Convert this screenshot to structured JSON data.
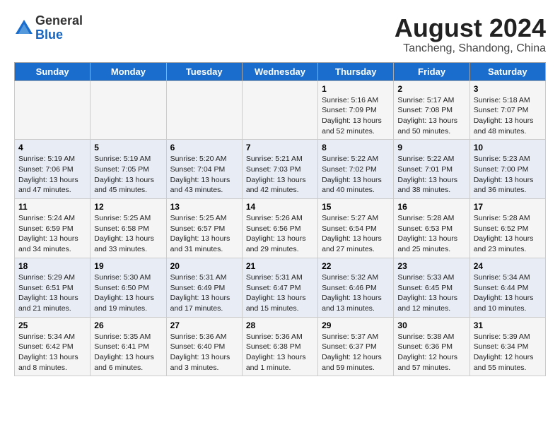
{
  "logo": {
    "general": "General",
    "blue": "Blue"
  },
  "title": {
    "month_year": "August 2024",
    "location": "Tancheng, Shandong, China"
  },
  "days_of_week": [
    "Sunday",
    "Monday",
    "Tuesday",
    "Wednesday",
    "Thursday",
    "Friday",
    "Saturday"
  ],
  "weeks": [
    [
      {
        "day": "",
        "info": ""
      },
      {
        "day": "",
        "info": ""
      },
      {
        "day": "",
        "info": ""
      },
      {
        "day": "",
        "info": ""
      },
      {
        "day": "1",
        "info": "Sunrise: 5:16 AM\nSunset: 7:09 PM\nDaylight: 13 hours\nand 52 minutes."
      },
      {
        "day": "2",
        "info": "Sunrise: 5:17 AM\nSunset: 7:08 PM\nDaylight: 13 hours\nand 50 minutes."
      },
      {
        "day": "3",
        "info": "Sunrise: 5:18 AM\nSunset: 7:07 PM\nDaylight: 13 hours\nand 48 minutes."
      }
    ],
    [
      {
        "day": "4",
        "info": "Sunrise: 5:19 AM\nSunset: 7:06 PM\nDaylight: 13 hours\nand 47 minutes."
      },
      {
        "day": "5",
        "info": "Sunrise: 5:19 AM\nSunset: 7:05 PM\nDaylight: 13 hours\nand 45 minutes."
      },
      {
        "day": "6",
        "info": "Sunrise: 5:20 AM\nSunset: 7:04 PM\nDaylight: 13 hours\nand 43 minutes."
      },
      {
        "day": "7",
        "info": "Sunrise: 5:21 AM\nSunset: 7:03 PM\nDaylight: 13 hours\nand 42 minutes."
      },
      {
        "day": "8",
        "info": "Sunrise: 5:22 AM\nSunset: 7:02 PM\nDaylight: 13 hours\nand 40 minutes."
      },
      {
        "day": "9",
        "info": "Sunrise: 5:22 AM\nSunset: 7:01 PM\nDaylight: 13 hours\nand 38 minutes."
      },
      {
        "day": "10",
        "info": "Sunrise: 5:23 AM\nSunset: 7:00 PM\nDaylight: 13 hours\nand 36 minutes."
      }
    ],
    [
      {
        "day": "11",
        "info": "Sunrise: 5:24 AM\nSunset: 6:59 PM\nDaylight: 13 hours\nand 34 minutes."
      },
      {
        "day": "12",
        "info": "Sunrise: 5:25 AM\nSunset: 6:58 PM\nDaylight: 13 hours\nand 33 minutes."
      },
      {
        "day": "13",
        "info": "Sunrise: 5:25 AM\nSunset: 6:57 PM\nDaylight: 13 hours\nand 31 minutes."
      },
      {
        "day": "14",
        "info": "Sunrise: 5:26 AM\nSunset: 6:56 PM\nDaylight: 13 hours\nand 29 minutes."
      },
      {
        "day": "15",
        "info": "Sunrise: 5:27 AM\nSunset: 6:54 PM\nDaylight: 13 hours\nand 27 minutes."
      },
      {
        "day": "16",
        "info": "Sunrise: 5:28 AM\nSunset: 6:53 PM\nDaylight: 13 hours\nand 25 minutes."
      },
      {
        "day": "17",
        "info": "Sunrise: 5:28 AM\nSunset: 6:52 PM\nDaylight: 13 hours\nand 23 minutes."
      }
    ],
    [
      {
        "day": "18",
        "info": "Sunrise: 5:29 AM\nSunset: 6:51 PM\nDaylight: 13 hours\nand 21 minutes."
      },
      {
        "day": "19",
        "info": "Sunrise: 5:30 AM\nSunset: 6:50 PM\nDaylight: 13 hours\nand 19 minutes."
      },
      {
        "day": "20",
        "info": "Sunrise: 5:31 AM\nSunset: 6:49 PM\nDaylight: 13 hours\nand 17 minutes."
      },
      {
        "day": "21",
        "info": "Sunrise: 5:31 AM\nSunset: 6:47 PM\nDaylight: 13 hours\nand 15 minutes."
      },
      {
        "day": "22",
        "info": "Sunrise: 5:32 AM\nSunset: 6:46 PM\nDaylight: 13 hours\nand 13 minutes."
      },
      {
        "day": "23",
        "info": "Sunrise: 5:33 AM\nSunset: 6:45 PM\nDaylight: 13 hours\nand 12 minutes."
      },
      {
        "day": "24",
        "info": "Sunrise: 5:34 AM\nSunset: 6:44 PM\nDaylight: 13 hours\nand 10 minutes."
      }
    ],
    [
      {
        "day": "25",
        "info": "Sunrise: 5:34 AM\nSunset: 6:42 PM\nDaylight: 13 hours\nand 8 minutes."
      },
      {
        "day": "26",
        "info": "Sunrise: 5:35 AM\nSunset: 6:41 PM\nDaylight: 13 hours\nand 6 minutes."
      },
      {
        "day": "27",
        "info": "Sunrise: 5:36 AM\nSunset: 6:40 PM\nDaylight: 13 hours\nand 3 minutes."
      },
      {
        "day": "28",
        "info": "Sunrise: 5:36 AM\nSunset: 6:38 PM\nDaylight: 13 hours\nand 1 minute."
      },
      {
        "day": "29",
        "info": "Sunrise: 5:37 AM\nSunset: 6:37 PM\nDaylight: 12 hours\nand 59 minutes."
      },
      {
        "day": "30",
        "info": "Sunrise: 5:38 AM\nSunset: 6:36 PM\nDaylight: 12 hours\nand 57 minutes."
      },
      {
        "day": "31",
        "info": "Sunrise: 5:39 AM\nSunset: 6:34 PM\nDaylight: 12 hours\nand 55 minutes."
      }
    ]
  ]
}
